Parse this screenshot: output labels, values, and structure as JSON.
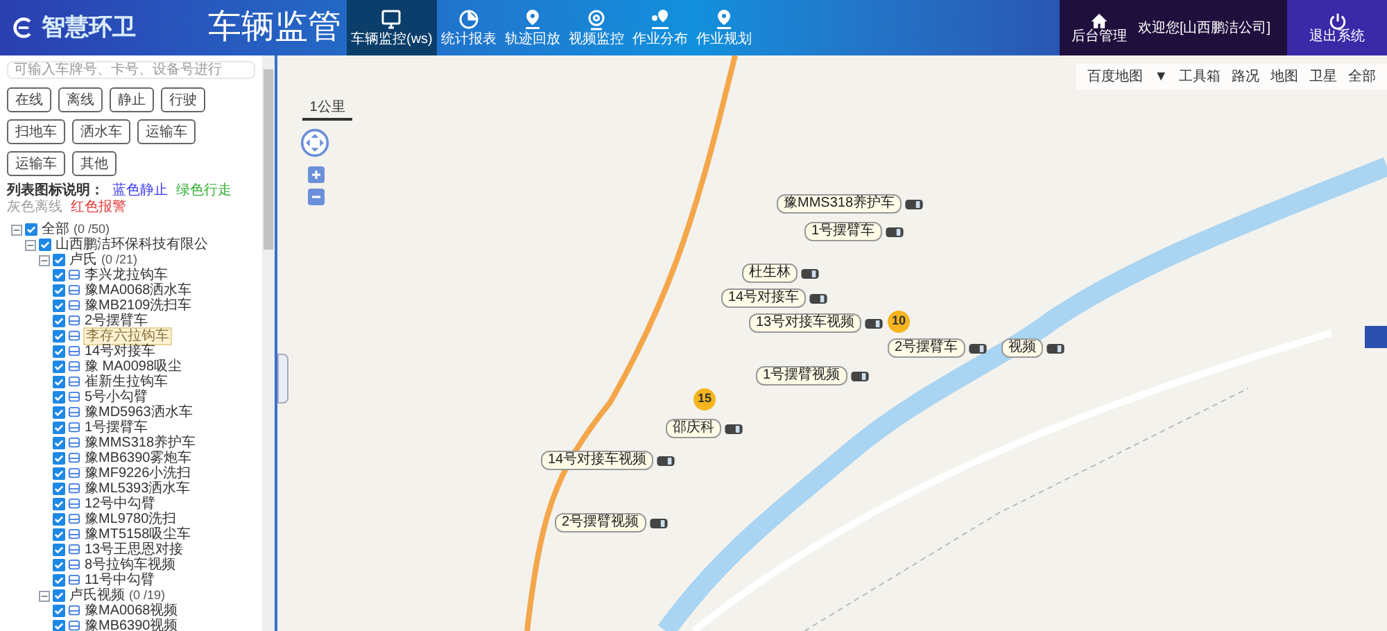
{
  "header": {
    "logo": "智慧环卫",
    "title": "车辆监管",
    "nav": [
      {
        "label": "车辆监控(ws)",
        "selected": true
      },
      {
        "label": "统计报表",
        "selected": false
      },
      {
        "label": "轨迹回放",
        "selected": false
      },
      {
        "label": "视频监控",
        "selected": false
      },
      {
        "label": "作业分布",
        "selected": false
      },
      {
        "label": "作业规划",
        "selected": false
      }
    ],
    "admin": "后台管理",
    "welcome": "欢迎您[山西鹏洁公司]",
    "logout": "退出系统"
  },
  "sidebar": {
    "search": {
      "placeholder": "可输入车牌号、卡号、设备号进行"
    },
    "filters": [
      "在线",
      "离线",
      "静止",
      "行驶",
      "扫地车",
      "洒水车",
      "运输车",
      "运输车",
      "其他"
    ],
    "legend": {
      "title": "列表图标说明：",
      "items": [
        {
          "label": "蓝色静止",
          "color": "#3b3bf5"
        },
        {
          "label": "绿色行走",
          "color": "#2fae2f"
        },
        {
          "label": "灰色离线",
          "color": "#a0a0a0"
        },
        {
          "label": "红色报警",
          "color": "#e53935"
        }
      ]
    },
    "tree": [
      {
        "label": "全部",
        "count": "(0 /50)",
        "checked": true,
        "expanded": true,
        "children": [
          {
            "label": "山西鹏洁环保科技有限公",
            "checked": true,
            "expanded": true,
            "children": [
              {
                "label": "卢氏",
                "count": "(0 /21)",
                "checked": true,
                "expanded": true,
                "children": [
                  {
                    "label": "李兴龙拉钩车",
                    "checked": true,
                    "selected": false
                  },
                  {
                    "label": "豫MA0068洒水车",
                    "checked": true,
                    "selected": false
                  },
                  {
                    "label": "豫MB2109洗扫车",
                    "checked": true,
                    "selected": false
                  },
                  {
                    "label": "2号摆臂车",
                    "checked": true,
                    "selected": false
                  },
                  {
                    "label": "李存六拉钩车",
                    "checked": true,
                    "selected": true
                  },
                  {
                    "label": "14号对接车",
                    "checked": true,
                    "selected": false
                  },
                  {
                    "label": "豫 MA0098吸尘",
                    "checked": true,
                    "selected": false
                  },
                  {
                    "label": "崔新生拉钩车",
                    "checked": true,
                    "selected": false
                  },
                  {
                    "label": "5号小勾臂",
                    "checked": true,
                    "selected": false
                  },
                  {
                    "label": "豫MD5963洒水车",
                    "checked": true,
                    "selected": false
                  },
                  {
                    "label": "1号摆臂车",
                    "checked": true,
                    "selected": false
                  },
                  {
                    "label": "豫MMS318养护车",
                    "checked": true,
                    "selected": false
                  },
                  {
                    "label": "豫MB6390雾炮车",
                    "checked": true,
                    "selected": false
                  },
                  {
                    "label": "豫MF9226小洗扫",
                    "checked": true,
                    "selected": false
                  },
                  {
                    "label": "豫ML5393洒水车",
                    "checked": true,
                    "selected": false
                  },
                  {
                    "label": "12号中勾臂",
                    "checked": true,
                    "selected": false
                  },
                  {
                    "label": "豫ML9780洗扫",
                    "checked": true,
                    "selected": false
                  },
                  {
                    "label": "豫MT5158吸尘车",
                    "checked": true,
                    "selected": false
                  },
                  {
                    "label": "13号王思恩对接",
                    "checked": true,
                    "selected": false
                  },
                  {
                    "label": "8号拉钩车视频",
                    "checked": true,
                    "selected": false
                  },
                  {
                    "label": "11号中勾臂",
                    "checked": true,
                    "selected": false
                  }
                ]
              },
              {
                "label": "卢氏视频",
                "count": "(0 /19)",
                "checked": true,
                "expanded": true,
                "children": [
                  {
                    "label": "豫MA0068视频",
                    "checked": true,
                    "selected": false
                  },
                  {
                    "label": "豫MB6390视频",
                    "checked": true,
                    "selected": false
                  }
                ]
              }
            ]
          }
        ]
      }
    ]
  },
  "map": {
    "toolbar": [
      "百度地图",
      "▼",
      "工具箱",
      "路况",
      "地图",
      "卫星",
      "全部"
    ],
    "scale": "1公里",
    "labels": [
      "豫MMS318养护车",
      "1号摆臂车",
      "杜生林",
      "14号对接车",
      "13号对接车视频",
      "2号摆臂车",
      "视频",
      "1号摆臂视频",
      "邵庆科",
      "14号对接车视频",
      "2号摆臂视频"
    ],
    "clusters": [
      "10",
      "15"
    ]
  }
}
